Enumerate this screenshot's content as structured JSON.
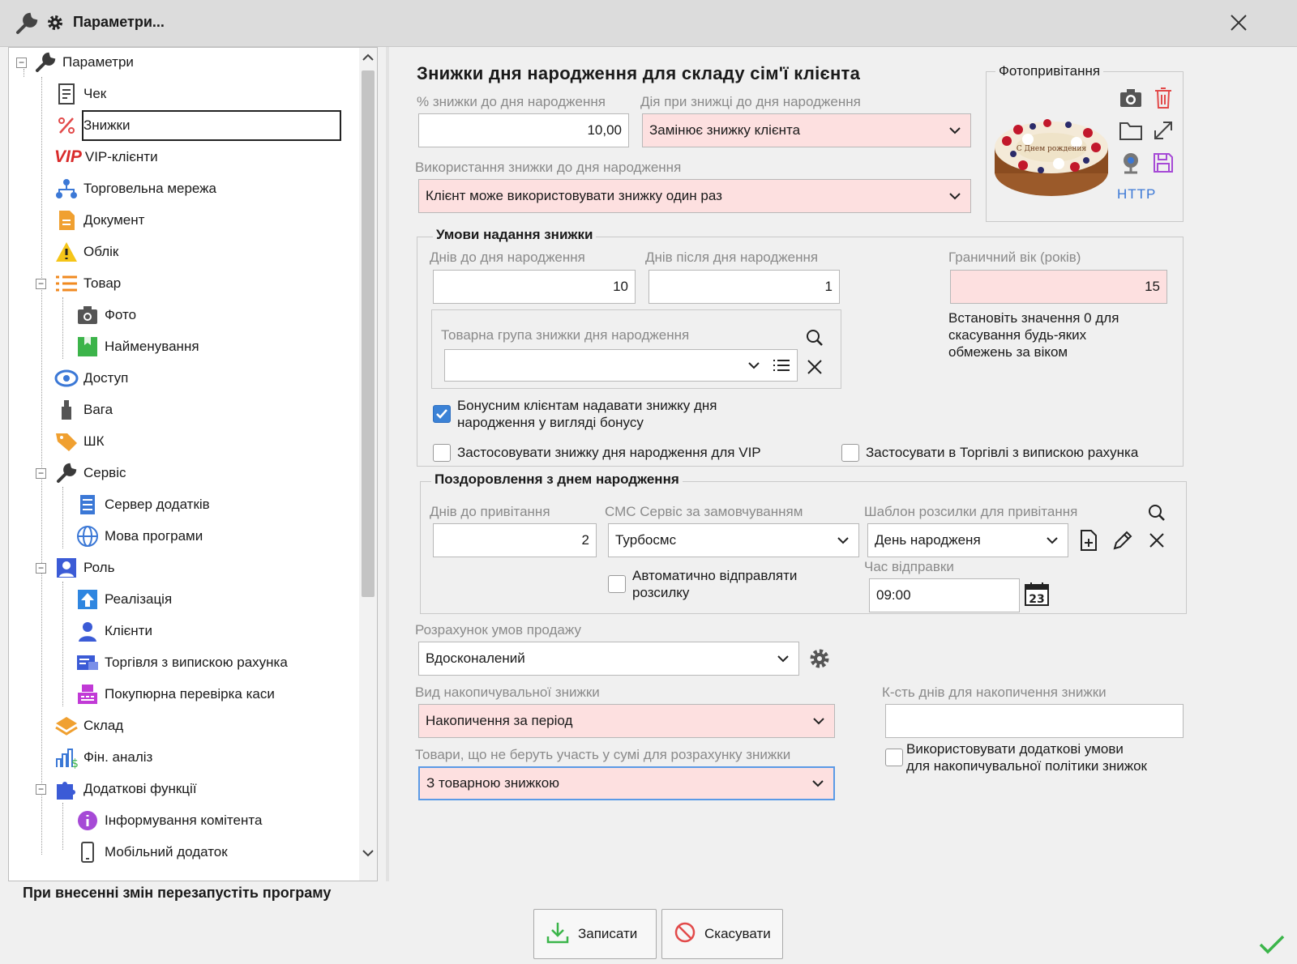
{
  "window": {
    "title": "Параметри..."
  },
  "tree": {
    "items": [
      {
        "label": "Параметри"
      },
      {
        "label": "Чек"
      },
      {
        "label": "Знижки"
      },
      {
        "label": "VIP-клієнти",
        "badge": "VIP"
      },
      {
        "label": "Торговельна мережа"
      },
      {
        "label": "Документ"
      },
      {
        "label": "Облік"
      },
      {
        "label": "Товар"
      },
      {
        "label": "Фото"
      },
      {
        "label": "Найменування"
      },
      {
        "label": "Доступ"
      },
      {
        "label": "Вага"
      },
      {
        "label": "ШК"
      },
      {
        "label": "Сервіс"
      },
      {
        "label": "Сервер додатків"
      },
      {
        "label": "Мова програми"
      },
      {
        "label": "Роль"
      },
      {
        "label": "Реалізація"
      },
      {
        "label": "Клієнти"
      },
      {
        "label": "Торгівля з випискою рахунка"
      },
      {
        "label": "Покупюрна перевірка каси"
      },
      {
        "label": "Склад"
      },
      {
        "label": "Фін. аналіз"
      },
      {
        "label": "Додаткові функції"
      },
      {
        "label": "Інформування комітента"
      },
      {
        "label": "Мобільний додаток"
      }
    ],
    "selected": "Знижки"
  },
  "restart_notice": "При внесенні змін перезапустіть програму",
  "birthday": {
    "heading": "Знижки дня народження для складу сім'ї клієнта",
    "discount_pct_label": "% знижки до дня народження",
    "discount_pct_value": "10,00",
    "action_label": "Дія при знижці до дня народження",
    "action_value": "Замінює знижку клієнта",
    "usage_label": "Використання знижки до дня народження",
    "usage_value": "Клієнт може використовувати знижку один раз"
  },
  "photo": {
    "label": "Фотопривітання",
    "http": "HTTP",
    "cake_text": "С Днем рождения"
  },
  "conditions": {
    "title": "Умови надання знижки",
    "days_before_label": "Днів до дня народження",
    "days_before_value": "10",
    "days_after_label": "Днів після дня народження",
    "days_after_value": "1",
    "age_label": "Граничний вік (років)",
    "age_value": "15",
    "age_hint": [
      "Встановіть значення 0 для",
      "скасування будь-яких",
      "обмежень за віком"
    ],
    "group_label": "Товарна група знижки дня народження",
    "group_value": "",
    "bonus_label": [
      "Бонусним клієнтам надавати знижку дня",
      "народження у вигляді бонусу"
    ],
    "bonus_checked": true,
    "vip_label": "Застосовувати знижку дня народження для VIP",
    "vip_checked": false,
    "trade_label": "Застосувати в Торгівлі з випискою рахунка",
    "trade_checked": false
  },
  "greeting": {
    "title": "Поздоровлення з днем народження",
    "days_label": "Днів до привітання",
    "days_value": "2",
    "sms_label": "СМС Сервіс за замовчуванням",
    "sms_value": "Турбосмс",
    "template_label": "Шаблон розсилки для привітання",
    "template_value": "День народженя",
    "auto_label": [
      "Автоматично відправляти",
      "розсилку"
    ],
    "auto_checked": false,
    "time_label": "Час відправки",
    "time_value": "09:00",
    "calendar_day": "23"
  },
  "sales": {
    "calc_label": "Розрахунок умов продажу",
    "calc_value": "Вдосконалений",
    "accum_label": "Вид накопичувальної знижки",
    "accum_value": "Накопичення за період",
    "days_accum_label": "К-сть днів для накопичення знижки",
    "days_accum_value": "",
    "excluded_label": "Товари, що не беруть участь у сумі для розрахунку знижки",
    "excluded_value": "З товарною знижкою",
    "extra_label": [
      "Використовувати додаткові умови",
      "для накопичувальної політики знижок"
    ],
    "extra_checked": false
  },
  "buttons": {
    "save": "Записати",
    "cancel": "Скасувати"
  },
  "colors": {
    "pink": "#fde0e0",
    "accent": "#3b82d6",
    "ok": "#3bb54a"
  }
}
